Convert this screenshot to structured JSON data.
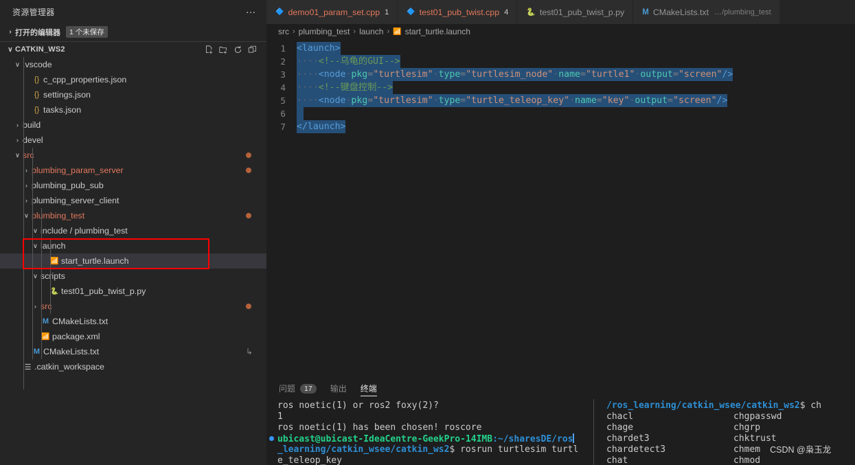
{
  "sidebar": {
    "title": "资源管理器",
    "more_label": "…",
    "open_editors": {
      "label": "打开的编辑器",
      "badge": "1 个未保存",
      "chevron": "›"
    },
    "root": {
      "label": "CATKIN_WS2",
      "chevron": "∨"
    },
    "root_actions": [
      "new-file-icon",
      "new-folder-icon",
      "refresh-icon",
      "collapse-all-icon"
    ],
    "tree": [
      {
        "label": ".vscode",
        "type": "folder",
        "state": "open",
        "indent": 1,
        "icon": "",
        "modified": false
      },
      {
        "label": "c_cpp_properties.json",
        "type": "file",
        "indent": 2,
        "icon": "{}",
        "iconClass": "json-ic",
        "modified": false
      },
      {
        "label": "settings.json",
        "type": "file",
        "indent": 2,
        "icon": "{}",
        "iconClass": "json-ic",
        "modified": false
      },
      {
        "label": "tasks.json",
        "type": "file",
        "indent": 2,
        "icon": "{}",
        "iconClass": "json-ic",
        "modified": false
      },
      {
        "label": "build",
        "type": "folder",
        "state": "closed",
        "indent": 1,
        "modified": false
      },
      {
        "label": "devel",
        "type": "folder",
        "state": "closed",
        "indent": 1,
        "modified": false
      },
      {
        "label": "src",
        "type": "folder",
        "state": "open",
        "indent": 1,
        "modified": true,
        "red": true
      },
      {
        "label": "plumbing_param_server",
        "type": "folder",
        "state": "closed",
        "indent": 2,
        "modified": true,
        "red": true
      },
      {
        "label": "plumbing_pub_sub",
        "type": "folder",
        "state": "closed",
        "indent": 2,
        "modified": false
      },
      {
        "label": "plumbing_server_client",
        "type": "folder",
        "state": "closed",
        "indent": 2,
        "modified": false
      },
      {
        "label": "plumbing_test",
        "type": "folder",
        "state": "open",
        "indent": 2,
        "modified": true,
        "red": true
      },
      {
        "label": "include / plumbing_test",
        "type": "folder",
        "state": "open",
        "indent": 3,
        "modified": false
      },
      {
        "label": "launch",
        "type": "folder",
        "state": "open",
        "indent": 3,
        "modified": false
      },
      {
        "label": "start_turtle.launch",
        "type": "file",
        "indent": 4,
        "icon": "📶",
        "iconClass": "xml-ic",
        "selected": true,
        "modified": false
      },
      {
        "label": "scripts",
        "type": "folder",
        "state": "open",
        "indent": 3,
        "modified": false
      },
      {
        "label": "test01_pub_twist_p.py",
        "type": "file",
        "indent": 4,
        "icon": "py",
        "iconClass": "py-ic",
        "modified": false
      },
      {
        "label": "src",
        "type": "folder",
        "state": "closed",
        "indent": 3,
        "modified": true,
        "red": true
      },
      {
        "label": "CMakeLists.txt",
        "type": "file",
        "indent": 3,
        "icon": "M",
        "iconClass": "m-ic",
        "modified": false
      },
      {
        "label": "package.xml",
        "type": "file",
        "indent": 3,
        "icon": "📶",
        "iconClass": "xml-ic",
        "modified": false
      },
      {
        "label": "CMakeLists.txt",
        "type": "file",
        "indent": 2,
        "icon": "M",
        "iconClass": "m-ic",
        "submark": "↳"
      },
      {
        "label": ".catkin_workspace",
        "type": "file",
        "indent": 1,
        "icon": "☰",
        "iconClass": "misc-ic"
      }
    ],
    "highlight_color": "#fe0000"
  },
  "tabs": [
    {
      "name": "demo01_param_set.cpp",
      "icon": "C+",
      "dirty": "1",
      "active": false,
      "red": true
    },
    {
      "name": "test01_pub_twist.cpp",
      "icon": "C+",
      "dirty": "4",
      "active": false,
      "red": true
    },
    {
      "name": "test01_pub_twist_p.py",
      "icon": "py",
      "dirty": "",
      "active": false,
      "red": false
    },
    {
      "name": "CMakeLists.txt",
      "icon": "M",
      "dirty": "",
      "path": "…/plumbing_test",
      "active": false,
      "red": false
    }
  ],
  "breadcrumb": {
    "items": [
      "src",
      "plumbing_test",
      "launch",
      "start_turtle.launch"
    ],
    "separator": "›",
    "file_icon": "xml-file-icon"
  },
  "editor": {
    "filename": "start_turtle.launch",
    "lines": [
      {
        "n": 1,
        "segments": [
          {
            "t": "<launch>",
            "c": "tagc"
          }
        ]
      },
      {
        "n": 2,
        "segments": [
          {
            "t": "····",
            "c": "dotws"
          },
          {
            "t": "<!--乌龟的GUI-->",
            "c": "cmtc"
          }
        ]
      },
      {
        "n": 3,
        "segments": [
          {
            "t": "····",
            "c": "dotws"
          },
          {
            "t": "<node",
            "c": "tagc"
          },
          {
            "t": "·",
            "c": "dotws"
          },
          {
            "t": "pkg",
            "c": "namec"
          },
          {
            "t": "=",
            "c": "punc"
          },
          {
            "t": "\"turtlesim\"",
            "c": "strc"
          },
          {
            "t": "·",
            "c": "dotws"
          },
          {
            "t": "type",
            "c": "namec"
          },
          {
            "t": "=",
            "c": "punc"
          },
          {
            "t": "\"turtlesim_node\"",
            "c": "strc"
          },
          {
            "t": "·",
            "c": "dotws"
          },
          {
            "t": "name",
            "c": "namec"
          },
          {
            "t": "=",
            "c": "punc"
          },
          {
            "t": "\"turtle1\"",
            "c": "strc"
          },
          {
            "t": "·",
            "c": "dotws"
          },
          {
            "t": "output",
            "c": "namec"
          },
          {
            "t": "=",
            "c": "punc"
          },
          {
            "t": "\"screen\"",
            "c": "strc"
          },
          {
            "t": "/>",
            "c": "tagc"
          }
        ]
      },
      {
        "n": 4,
        "segments": [
          {
            "t": "····",
            "c": "dotws"
          },
          {
            "t": "<!--键盘控制-->",
            "c": "cmtc"
          }
        ]
      },
      {
        "n": 5,
        "segments": [
          {
            "t": "····",
            "c": "dotws"
          },
          {
            "t": "<node",
            "c": "tagc"
          },
          {
            "t": "·",
            "c": "dotws"
          },
          {
            "t": "pkg",
            "c": "namec"
          },
          {
            "t": "=",
            "c": "punc"
          },
          {
            "t": "\"turtlesim\"",
            "c": "strc"
          },
          {
            "t": "·",
            "c": "dotws"
          },
          {
            "t": "type",
            "c": "namec"
          },
          {
            "t": "=",
            "c": "punc"
          },
          {
            "t": "\"turtle_teleop_key\"",
            "c": "strc"
          },
          {
            "t": "·",
            "c": "dotws"
          },
          {
            "t": "name",
            "c": "namec"
          },
          {
            "t": "=",
            "c": "punc"
          },
          {
            "t": "\"key\"",
            "c": "strc"
          },
          {
            "t": "·",
            "c": "dotws"
          },
          {
            "t": "output",
            "c": "namec"
          },
          {
            "t": "=",
            "c": "punc"
          },
          {
            "t": "\"screen\"",
            "c": "strc"
          },
          {
            "t": "/>",
            "c": "tagc"
          }
        ]
      },
      {
        "n": 6,
        "segments": [
          {
            "t": "",
            "c": "dotws"
          }
        ]
      },
      {
        "n": 7,
        "segments": [
          {
            "t": "</launch>",
            "c": "tagc"
          }
        ]
      }
    ]
  },
  "panel": {
    "tabs": [
      {
        "label": "问题",
        "badge": "17",
        "active": false
      },
      {
        "label": "输出",
        "badge": "",
        "active": false
      },
      {
        "label": "终端",
        "badge": "",
        "active": true
      }
    ],
    "terminal_left": [
      {
        "text": "ros noetic(1) or ros2 foxy(2)?",
        "style": "plain"
      },
      {
        "text": "1",
        "style": "plain"
      },
      {
        "text": "ros noetic(1) has been chosen! roscore",
        "style": "plain"
      },
      {
        "text": "ubicast@ubicast-IdeaCentre-GeekPro-14IMB",
        "style": "prompt-start",
        "suffix": ":~/sharesDE/ros"
      },
      {
        "text": "_learning/catkin_wsee/catkin_ws2",
        "style": "path",
        "suffix": "$ rosrun turtlesim turtl"
      },
      {
        "text": "e_teleop_key",
        "style": "plain"
      }
    ],
    "terminal_right": [
      {
        "text": "/ros_learning/catkin_wsee/catkin_ws2",
        "style": "path",
        "suffix": "$ ch"
      },
      {
        "col1": "chacl",
        "col2": "chgpasswd"
      },
      {
        "col1": "chage",
        "col2": "chgrp"
      },
      {
        "col1": "chardet3",
        "col2": "chktrust"
      },
      {
        "col1": "chardetect3",
        "col2": "chmem",
        "extra": "CSDN @枭玉龙"
      },
      {
        "col1": "chat",
        "col2": "chmod"
      }
    ]
  }
}
